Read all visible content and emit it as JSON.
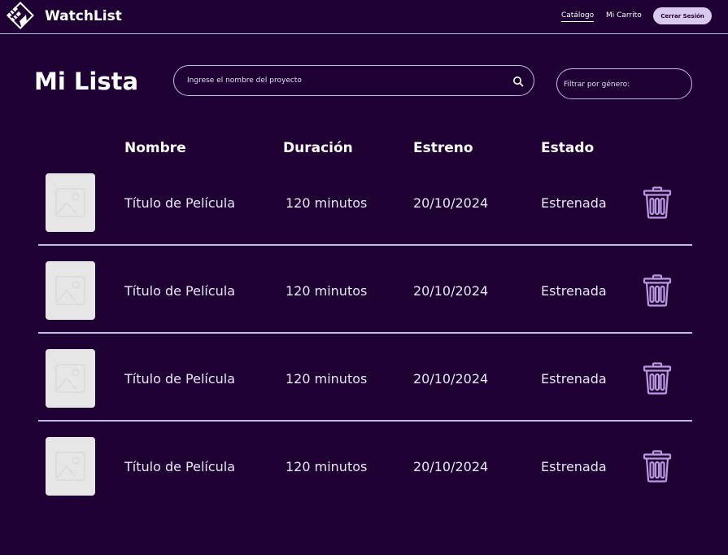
{
  "header": {
    "brand": "WatchList",
    "nav": [
      "Catálogo",
      "Mi Carrito"
    ],
    "logout_label": "Cerrar Sesión"
  },
  "page": {
    "title": "Mi Lista",
    "search_placeholder": "Ingrese el nombre del proyecto",
    "filter_placeholder": "Filtrar por género:"
  },
  "table": {
    "columns": [
      "Nombre",
      "Duración",
      "Estreno",
      "Estado"
    ],
    "rows": [
      {
        "title": "Título de Película",
        "duration": "120 minutos",
        "release": "20/10/2024",
        "status": "Estrenada"
      },
      {
        "title": "Título de Película",
        "duration": "120 minutos",
        "release": "20/10/2024",
        "status": "Estrenada"
      },
      {
        "title": "Título de Película",
        "duration": "120 minutos",
        "release": "20/10/2024",
        "status": "Estrenada"
      },
      {
        "title": "Título de Película",
        "duration": "120 minutos",
        "release": "20/10/2024",
        "status": "Estrenada"
      }
    ]
  },
  "icons": {
    "logo": "clapperboard-icon",
    "search": "search-icon",
    "thumbnail": "image-placeholder-icon",
    "delete": "trash-icon"
  },
  "colors": {
    "background": "#1e0033",
    "accent": "#c9b7e8",
    "button": "#d9c9ee",
    "thumbnail": "#e6e6e6"
  }
}
